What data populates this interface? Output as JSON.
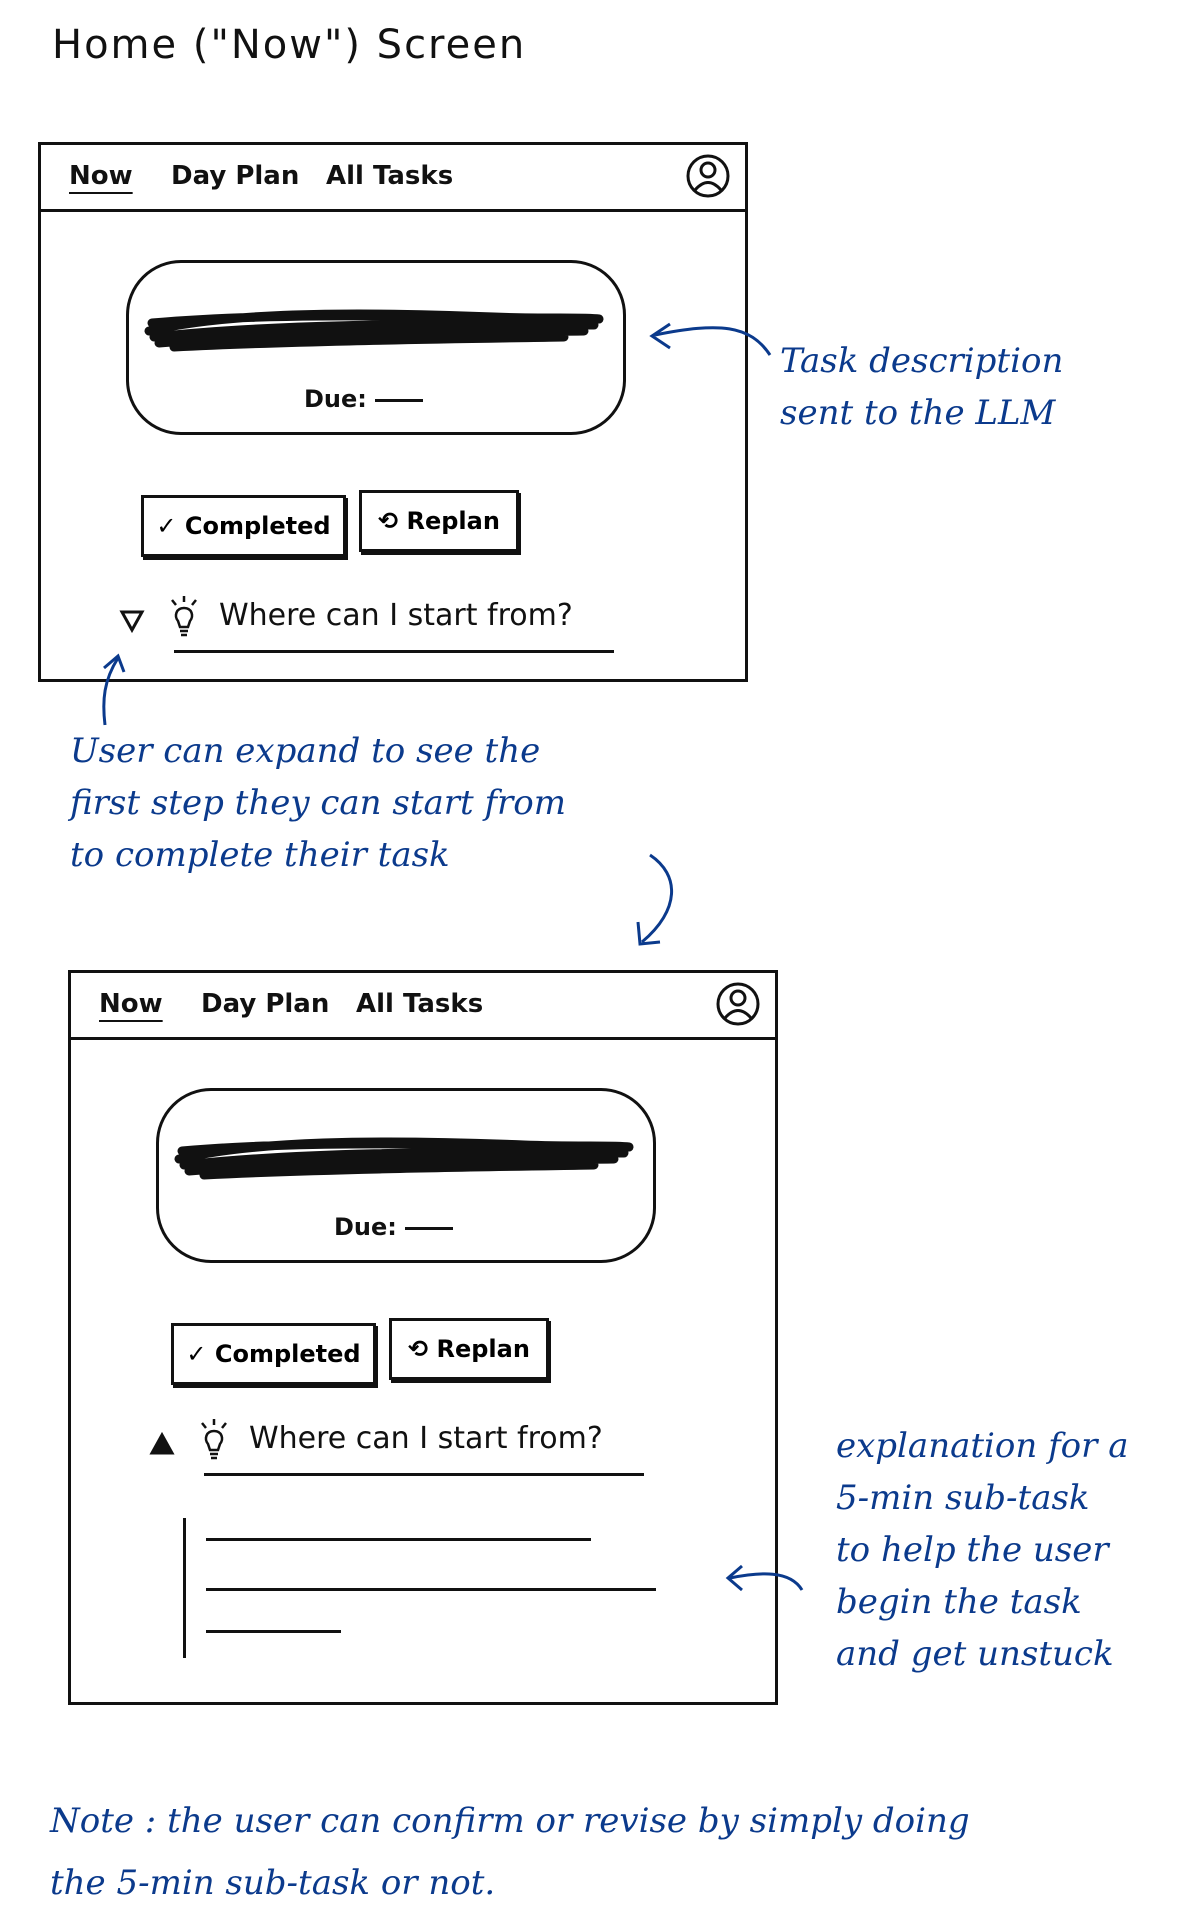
{
  "title": "Home (\"Now\") Screen",
  "mockups": [
    {
      "nav": {
        "now": "Now",
        "day_plan": "Day Plan",
        "all_tasks": "All Tasks"
      },
      "task": {
        "due_label": "Due:"
      },
      "buttons": {
        "completed": "✓ Completed",
        "replan": "⟲ Replan"
      },
      "hint": {
        "text": "Where can I start from?",
        "state": "collapsed"
      }
    },
    {
      "nav": {
        "now": "Now",
        "day_plan": "Day Plan",
        "all_tasks": "All Tasks"
      },
      "task": {
        "due_label": "Due:"
      },
      "buttons": {
        "completed": "✓ Completed",
        "replan": "⟲ Replan"
      },
      "hint": {
        "text": "Where can I start from?",
        "state": "expanded"
      }
    }
  ],
  "annotations": {
    "task_description": [
      "Task description",
      "sent to the LLM"
    ],
    "expand": [
      "User can expand to see the",
      "first step they can start from",
      "to complete their task"
    ],
    "explanation": [
      "explanation for a",
      "5-min sub-task",
      "to help the user",
      "begin the task",
      "and get unstuck"
    ],
    "note": [
      "Note : the user can confirm or revise by simply doing",
      "the 5-min sub-task or not."
    ]
  },
  "colors": {
    "ink": "#111111",
    "annotation_blue": "#0b3a8c"
  },
  "icons": [
    "avatar-icon",
    "checkmark-icon",
    "replan-icon",
    "triangle-down-icon",
    "triangle-up-icon",
    "lightbulb-icon"
  ]
}
